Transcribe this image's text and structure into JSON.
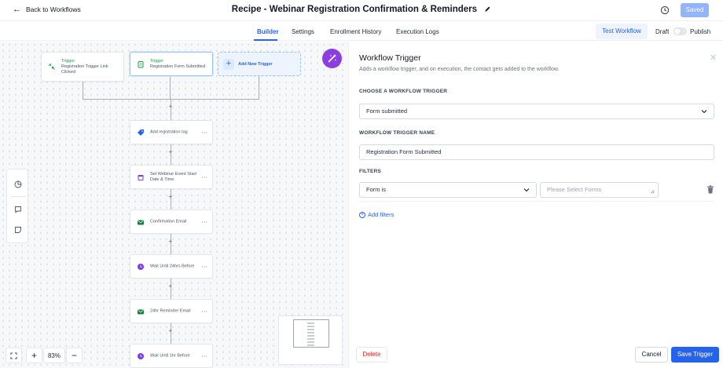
{
  "header": {
    "back_label": "Back to Workflows",
    "title": "Recipe - Webinar Registration Confirmation & Reminders",
    "saved_label": "Saved"
  },
  "tabs": [
    {
      "label": "Builder",
      "active": true
    },
    {
      "label": "Settings",
      "active": false
    },
    {
      "label": "Enrollment History",
      "active": false
    },
    {
      "label": "Execution Logs",
      "active": false
    }
  ],
  "toolbar": {
    "test_label": "Test Workflow",
    "draft_label": "Draft",
    "publish_label": "Publish",
    "publish_on": false
  },
  "canvas": {
    "triggers": [
      {
        "kicker": "Trigger",
        "name": "Registration Trigger Link Clicked",
        "icon": "link-icon",
        "color": "#16a34a"
      },
      {
        "kicker": "Trigger",
        "name": "Registration Form Submitted",
        "icon": "form-icon",
        "color": "#16a34a"
      }
    ],
    "add_trigger_label": "Add New Trigger",
    "actions": [
      {
        "label": "Add registration tag",
        "icon": "tag-icon",
        "color": "#2563eb"
      },
      {
        "label": "Set Webinar Event Start Date & Time",
        "icon": "calendar-icon",
        "color": "#7c3aed"
      },
      {
        "label": "Confirmation Email",
        "icon": "email-icon",
        "color": "#15803d"
      },
      {
        "label": "Wait Until 24hrs Before",
        "icon": "clock-icon",
        "color": "#7c3aed"
      },
      {
        "label": "24hr Reminder Email",
        "icon": "email-icon",
        "color": "#15803d"
      },
      {
        "label": "Wait Until 1hr Before",
        "icon": "clock-icon",
        "color": "#7c3aed"
      }
    ],
    "zoom_level": "83%"
  },
  "panel": {
    "title": "Workflow Trigger",
    "subtitle": "Adds a workflow trigger, and on execution, the contact gets added to the workflow.",
    "choose_label": "CHOOSE A WORKFLOW TRIGGER",
    "trigger_value": "Form submitted",
    "name_label": "WORKFLOW TRIGGER NAME",
    "name_value": "Registration Form Submitted",
    "filters_label": "FILTERS",
    "filter_field": "Form is",
    "filter_placeholder": "Please Select Forms",
    "add_filters_label": "Add filters",
    "delete_label": "Delete",
    "cancel_label": "Cancel",
    "save_label": "Save Trigger"
  },
  "colors": {
    "accent": "#2563eb",
    "wand": "#8b3fe0"
  }
}
